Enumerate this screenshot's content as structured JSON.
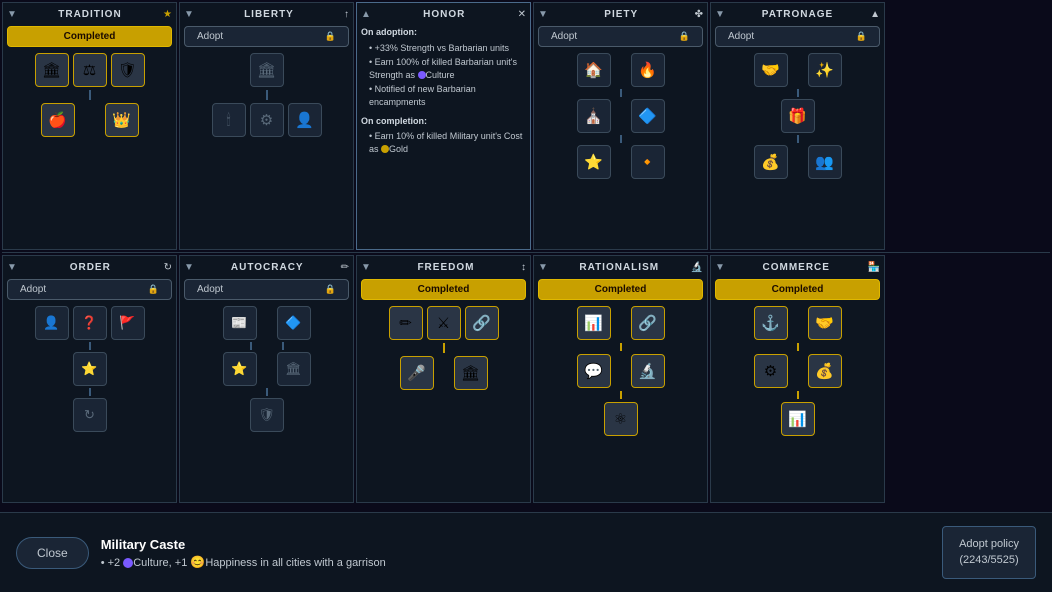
{
  "trees": {
    "top": [
      {
        "id": "tradition",
        "title": "TRADITION",
        "title_icon": "★",
        "status": "completed",
        "status_label": "Completed",
        "icons_row1": [
          "🏛",
          "⚖",
          "🛡"
        ],
        "icons_row2": [
          "🍎",
          "👑"
        ],
        "has_connector": true
      },
      {
        "id": "liberty",
        "title": "LIBERTY",
        "title_icon": "↑",
        "status": "adopt",
        "status_label": "Adopt",
        "icons_row1": [
          "🏛"
        ],
        "icons_row2": [
          "🕯",
          "⚙",
          "👤"
        ],
        "has_connector": true
      },
      {
        "id": "honor",
        "title": "HONOR",
        "title_icon": "✕",
        "status": "tooltip",
        "adoption_title": "On adoption:",
        "adoption_items": [
          "+33% Strength vs Barbarian units",
          "Earn 100% of killed Barbarian unit's Strength as 🔵Culture",
          "Notified of new Barbarian encampments"
        ],
        "completion_title": "On completion:",
        "completion_items": [
          "Earn 10% of killed Military unit's Cost as 💛Gold"
        ]
      },
      {
        "id": "piety",
        "title": "PIETY",
        "title_icon": "✤",
        "status": "adopt",
        "status_label": "Adopt",
        "icons_row1": [
          "🏠",
          "🔥"
        ],
        "icons_row2": [
          "⛪",
          "🔷"
        ],
        "icons_row3": [
          "⭐",
          "🔸"
        ],
        "has_connector": true
      },
      {
        "id": "patronage",
        "title": "PATRONAGE",
        "title_icon": "▲",
        "status": "adopt",
        "status_label": "Adopt",
        "icons_row1": [
          "🤝",
          "✨"
        ],
        "icons_row2": [
          "🎁"
        ],
        "icons_row3": [
          "💰",
          "👥"
        ],
        "has_connector": true
      }
    ],
    "bottom": [
      {
        "id": "order",
        "title": "ORDER",
        "title_icon": "↻",
        "status": "adopt",
        "status_label": "Adopt",
        "icons_row1": [
          "👤",
          "❓",
          "🚩"
        ],
        "icons_row2": [
          "⭐"
        ],
        "icons_row3": [
          "↻"
        ],
        "has_connector": true
      },
      {
        "id": "autocracy",
        "title": "AUTOCRACY",
        "title_icon": "✏",
        "status": "adopt",
        "status_label": "Adopt",
        "icons_row1": [
          "📰",
          "🔷"
        ],
        "icons_row2": [
          "⭐",
          "🏛"
        ],
        "icons_row3": [
          "🛡"
        ],
        "has_connector": true
      },
      {
        "id": "freedom",
        "title": "FREEDOM",
        "title_icon": "↕",
        "status": "completed",
        "status_label": "Completed",
        "icons_row1": [
          "✏",
          "⚔",
          "🔗"
        ],
        "icons_row2": [
          "🎤",
          "🏛"
        ],
        "has_connector": true
      },
      {
        "id": "rationalism",
        "title": "RATIONALISM",
        "title_icon": "🔬",
        "status": "completed",
        "status_label": "Completed",
        "icons_row1": [
          "📊",
          "🔗"
        ],
        "icons_row2": [
          "💬",
          "🔬"
        ],
        "icons_row3": [
          "⚛"
        ],
        "has_connector": true
      },
      {
        "id": "commerce",
        "title": "COMMERCE",
        "title_icon": "🏪",
        "status": "completed",
        "status_label": "Completed",
        "icons_row1": [
          "⚓",
          "🤝"
        ],
        "icons_row2": [
          "⚙",
          "💰"
        ],
        "icons_row3": [
          "📊"
        ],
        "has_connector": true
      }
    ]
  },
  "bottom_bar": {
    "close_label": "Close",
    "info_title": "Military Caste",
    "info_desc": "• +2 🔵Culture, +1 😊Happiness in all cities with a garrison",
    "adopt_btn_line1": "Adopt policy",
    "adopt_btn_line2": "(2243/5525)"
  }
}
